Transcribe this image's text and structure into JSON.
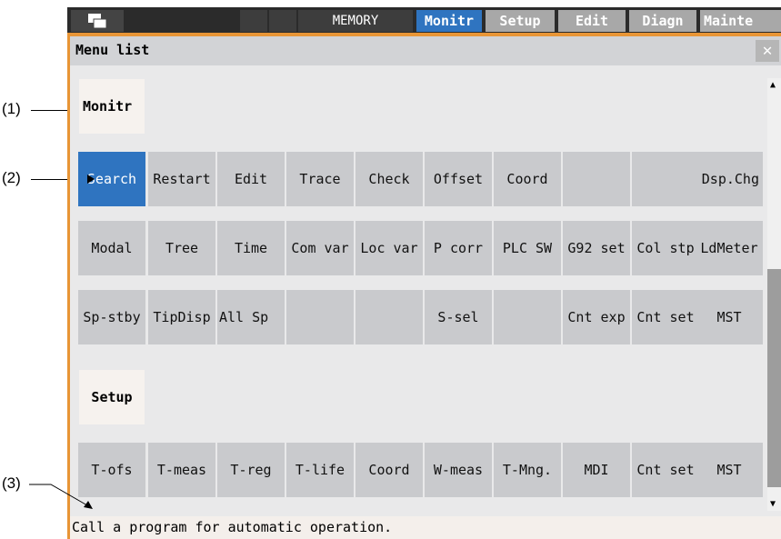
{
  "topbar": {
    "mode": "MEMORY",
    "tabs": [
      "Monitr",
      "Setup",
      "Edit",
      "Diagn",
      "Mainte"
    ]
  },
  "window": {
    "title": "Menu list",
    "close": "✕"
  },
  "categories": [
    {
      "name": "Monitr",
      "rows": [
        [
          "Search",
          "Restart",
          "Edit",
          "Trace",
          "Check",
          "Offset",
          "Coord",
          "",
          "",
          "Dsp.Chg"
        ],
        [
          "Modal",
          "Tree",
          "Time",
          "Com var",
          "Loc var",
          "P corr",
          "PLC SW",
          "G92 set",
          "Col stp",
          "LdMeter"
        ],
        [
          "Sp-stby",
          "TipDisp",
          "All Sp",
          "",
          "",
          "S-sel",
          "",
          "Cnt exp",
          "Cnt set",
          "MST"
        ]
      ]
    },
    {
      "name": "Setup",
      "rows": [
        [
          "T-ofs",
          "T-meas",
          "T-reg",
          "T-life",
          "Coord",
          "W-meas",
          "T-Mng.",
          "MDI",
          "Cnt set",
          "MST"
        ]
      ]
    }
  ],
  "status_message": "Call a program for automatic operation.",
  "annotations": [
    "(1)",
    "(2)",
    "(3)"
  ],
  "colors": {
    "accent": "#2f74c0",
    "frame": "#e89536"
  }
}
